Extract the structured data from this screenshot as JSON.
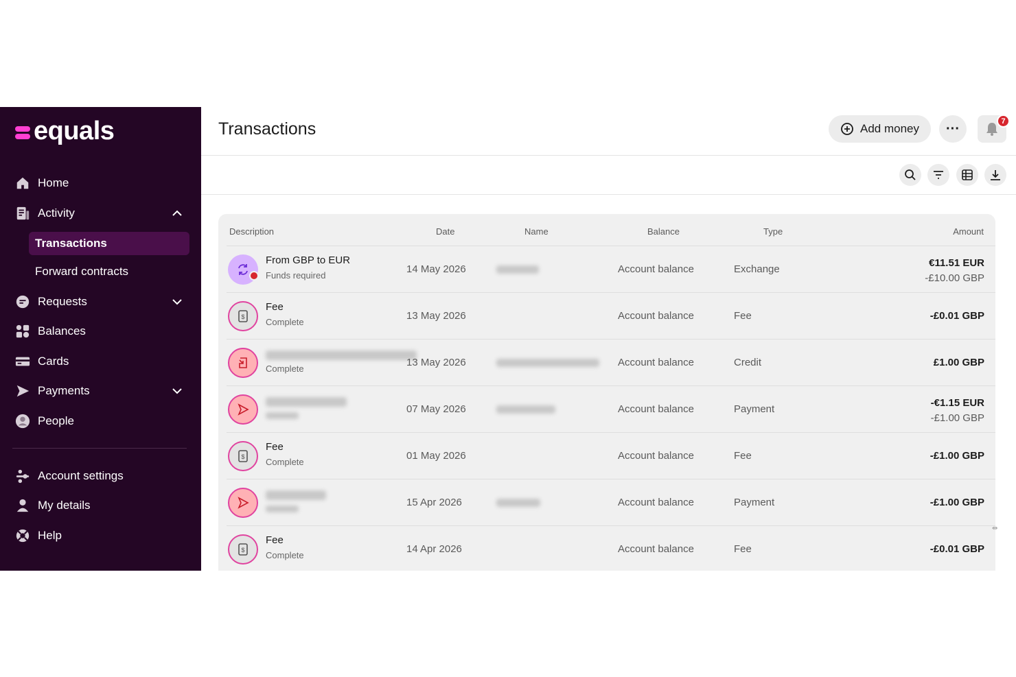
{
  "app": {
    "logo_text": "equals",
    "brand_color": "#ff3fd2",
    "sidebar_bg": "#240625"
  },
  "sidebar": {
    "items": [
      {
        "label": "Home",
        "icon": "home-icon"
      },
      {
        "label": "Activity",
        "icon": "activity-icon",
        "expanded": true
      },
      {
        "label": "Requests",
        "icon": "requests-icon"
      },
      {
        "label": "Balances",
        "icon": "balances-icon"
      },
      {
        "label": "Cards",
        "icon": "cards-icon"
      },
      {
        "label": "Payments",
        "icon": "payments-icon"
      },
      {
        "label": "People",
        "icon": "people-icon"
      },
      {
        "label": "Account settings",
        "icon": "account-settings-icon"
      },
      {
        "label": "My details",
        "icon": "my-details-icon"
      },
      {
        "label": "Help",
        "icon": "help-icon"
      }
    ],
    "sub_items": [
      {
        "label": "Transactions",
        "active": true
      },
      {
        "label": "Forward contracts",
        "active": false
      }
    ]
  },
  "header": {
    "title": "Transactions",
    "add_money_label": "Add money",
    "more_label": "···",
    "notification_count": "7"
  },
  "table": {
    "columns": [
      "Description",
      "Date",
      "Name",
      "Balance",
      "Type",
      "Amount"
    ],
    "rows": [
      {
        "title": "From GBP to EUR",
        "status": "Funds required",
        "date": "14 May 2026",
        "balance": "Account balance",
        "type": "Exchange",
        "amount": "€11.51 EUR",
        "amount_secondary": "-£10.00 GBP",
        "icon": "exchange-icon"
      },
      {
        "title": "Fee",
        "status": "Complete",
        "date": "13 May 2026",
        "balance": "Account balance",
        "type": "Fee",
        "amount": "-£0.01 GBP",
        "amount_secondary": "",
        "icon": "fee-receipt-icon"
      },
      {
        "title": "",
        "status": "Complete",
        "date": "13 May 2026",
        "balance": "Account balance",
        "type": "Credit",
        "amount": "£1.00 GBP",
        "amount_secondary": "",
        "icon": "incoming-credit-icon"
      },
      {
        "title": "",
        "status": "",
        "date": "07 May 2026",
        "balance": "Account balance",
        "type": "Payment",
        "amount": "-€1.15 EUR",
        "amount_secondary": "-£1.00 GBP",
        "icon": "payment-send-icon"
      },
      {
        "title": "Fee",
        "status": "Complete",
        "date": "01 May 2026",
        "balance": "Account balance",
        "type": "Fee",
        "amount": "-£1.00 GBP",
        "amount_secondary": "",
        "icon": "fee-receipt-icon"
      },
      {
        "title": "",
        "status": "",
        "date": "15 Apr 2026",
        "balance": "Account balance",
        "type": "Payment",
        "amount": "-£1.00 GBP",
        "amount_secondary": "",
        "icon": "payment-send-icon"
      },
      {
        "title": "Fee",
        "status": "Complete",
        "date": "14 Apr 2026",
        "balance": "Account balance",
        "type": "Fee",
        "amount": "-£0.01 GBP",
        "amount_secondary": "",
        "icon": "fee-receipt-icon"
      }
    ]
  }
}
